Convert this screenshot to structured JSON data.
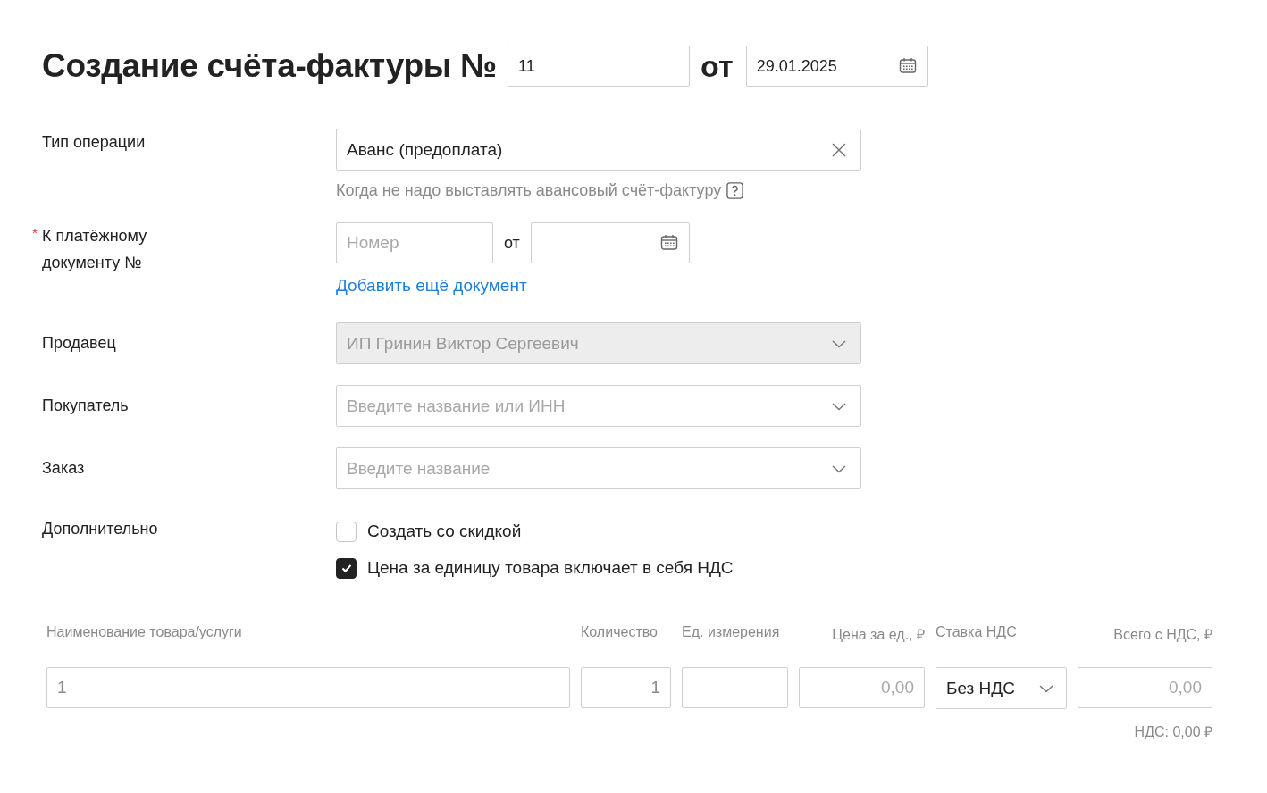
{
  "header": {
    "title": "Создание счёта-фактуры №",
    "number": "11",
    "from": "от",
    "date": "29.01.2025"
  },
  "fields": [
    {
      "kind": "clearable",
      "label": "Тип операции",
      "value": "Аванс (предоплата)",
      "hint": "Когда не надо выставлять авансовый счёт-фактуру"
    },
    {
      "kind": "document",
      "label": "К платёжному документу №",
      "required_mark": "*",
      "placeholder": "Номер",
      "from": "от",
      "link": "Добавить ещё документ"
    },
    {
      "kind": "select",
      "label": "Продавец",
      "disabled": true,
      "value": "ИП Гринин Виктор Сергеевич"
    },
    {
      "kind": "select",
      "label": "Покупатель",
      "disabled": false,
      "placeholder": "Введите название или ИНН"
    },
    {
      "kind": "select",
      "label": "Заказ",
      "disabled": false,
      "placeholder": "Введите название"
    },
    {
      "kind": "checks",
      "label": "Дополнительно",
      "options": [
        {
          "label": "Создать со скидкой",
          "checked": false
        },
        {
          "label": "Цена за единицу товара включает в себя НДС",
          "checked": true
        }
      ]
    }
  ],
  "table": {
    "columns": [
      "Наименование товара/услуги",
      "Количество",
      "Ед. измерения",
      "Цена за ед., ₽",
      "Ставка НДС",
      "Всего с НДС, ₽"
    ],
    "rows": [
      {
        "cells": [
          {
            "kind": "input",
            "value": "1"
          },
          {
            "kind": "input",
            "value": "1"
          },
          {
            "kind": "input"
          },
          {
            "kind": "input",
            "placeholder": "0,00"
          },
          {
            "kind": "select",
            "value": "Без НДС"
          },
          {
            "kind": "input",
            "placeholder": "0,00"
          }
        ]
      }
    ],
    "vat_total": "НДС: 0,00 ₽"
  }
}
